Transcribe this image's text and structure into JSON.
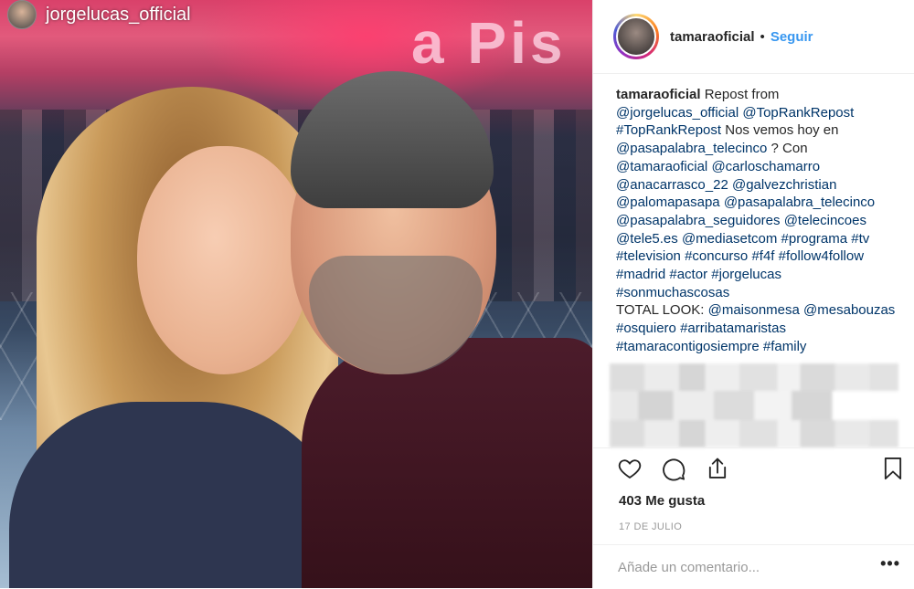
{
  "photo": {
    "tag_handle": "jorgelucas_official",
    "screen_text": "a Pis",
    "alt": "selfie"
  },
  "header": {
    "username": "tamaraoficial",
    "separator": "•",
    "follow_label": "Seguir"
  },
  "caption": {
    "lines": [
      [
        {
          "t": "tamaraoficial",
          "k": "user"
        },
        {
          "t": " Repost from",
          "k": "text"
        }
      ],
      [
        {
          "t": "@jorgelucas_official",
          "k": "link"
        },
        {
          "t": " ",
          "k": "text"
        },
        {
          "t": "@TopRankRepost",
          "k": "link"
        }
      ],
      [
        {
          "t": "#TopRankRepost",
          "k": "link"
        },
        {
          "t": " Nos vemos hoy en",
          "k": "text"
        }
      ],
      [
        {
          "t": "@pasapalabra_telecinco",
          "k": "link"
        },
        {
          "t": " ? Con",
          "k": "text"
        }
      ],
      [
        {
          "t": "@tamaraoficial",
          "k": "link"
        },
        {
          "t": " ",
          "k": "text"
        },
        {
          "t": "@carloschamarro",
          "k": "link"
        }
      ],
      [
        {
          "t": "@anacarrasco_22",
          "k": "link"
        },
        {
          "t": " ",
          "k": "text"
        },
        {
          "t": "@galvezchristian",
          "k": "link"
        }
      ],
      [
        {
          "t": "@palomapasapa",
          "k": "link"
        },
        {
          "t": " ",
          "k": "text"
        },
        {
          "t": "@pasapalabra_telecinco",
          "k": "link"
        }
      ],
      [
        {
          "t": "@pasapalabra_seguidores",
          "k": "link"
        },
        {
          "t": " ",
          "k": "text"
        },
        {
          "t": "@telecincoes",
          "k": "link"
        }
      ],
      [
        {
          "t": "@tele5.es",
          "k": "link"
        },
        {
          "t": " ",
          "k": "text"
        },
        {
          "t": "@mediasetcom",
          "k": "link"
        },
        {
          "t": " ",
          "k": "text"
        },
        {
          "t": "#programa",
          "k": "link"
        },
        {
          "t": " ",
          "k": "text"
        },
        {
          "t": "#tv",
          "k": "link"
        }
      ],
      [
        {
          "t": "#television",
          "k": "link"
        },
        {
          "t": " ",
          "k": "text"
        },
        {
          "t": "#concurso",
          "k": "link"
        },
        {
          "t": " ",
          "k": "text"
        },
        {
          "t": "#f4f",
          "k": "link"
        },
        {
          "t": " ",
          "k": "text"
        },
        {
          "t": "#follow4follow",
          "k": "link"
        }
      ],
      [
        {
          "t": "#madrid",
          "k": "link"
        },
        {
          "t": " ",
          "k": "text"
        },
        {
          "t": "#actor",
          "k": "link"
        },
        {
          "t": " ",
          "k": "text"
        },
        {
          "t": "#jorgelucas",
          "k": "link"
        }
      ],
      [
        {
          "t": "#sonmuchascosas",
          "k": "link"
        }
      ],
      [
        {
          "t": "TOTAL LOOK: ",
          "k": "text"
        },
        {
          "t": "@maisonmesa",
          "k": "link"
        },
        {
          "t": " ",
          "k": "text"
        },
        {
          "t": "@mesabouzas",
          "k": "link"
        }
      ],
      [
        {
          "t": "#osquiero",
          "k": "link"
        },
        {
          "t": " ",
          "k": "text"
        },
        {
          "t": "#arribatamaristas",
          "k": "link"
        }
      ],
      [
        {
          "t": "#tamaracontigosiempre",
          "k": "link"
        },
        {
          "t": " ",
          "k": "text"
        },
        {
          "t": "#family",
          "k": "link"
        }
      ]
    ]
  },
  "actions": {
    "icons": [
      "heart-icon",
      "comment-icon",
      "share-icon",
      "bookmark-icon"
    ]
  },
  "likes_text": "403 Me gusta",
  "date_text": "17 DE JULIO",
  "comment": {
    "placeholder": "Añade un comentario...",
    "more_label": "•••"
  },
  "colors": {
    "link": "#003569",
    "follow": "#3897f0",
    "text": "#262626",
    "muted": "#999999"
  }
}
